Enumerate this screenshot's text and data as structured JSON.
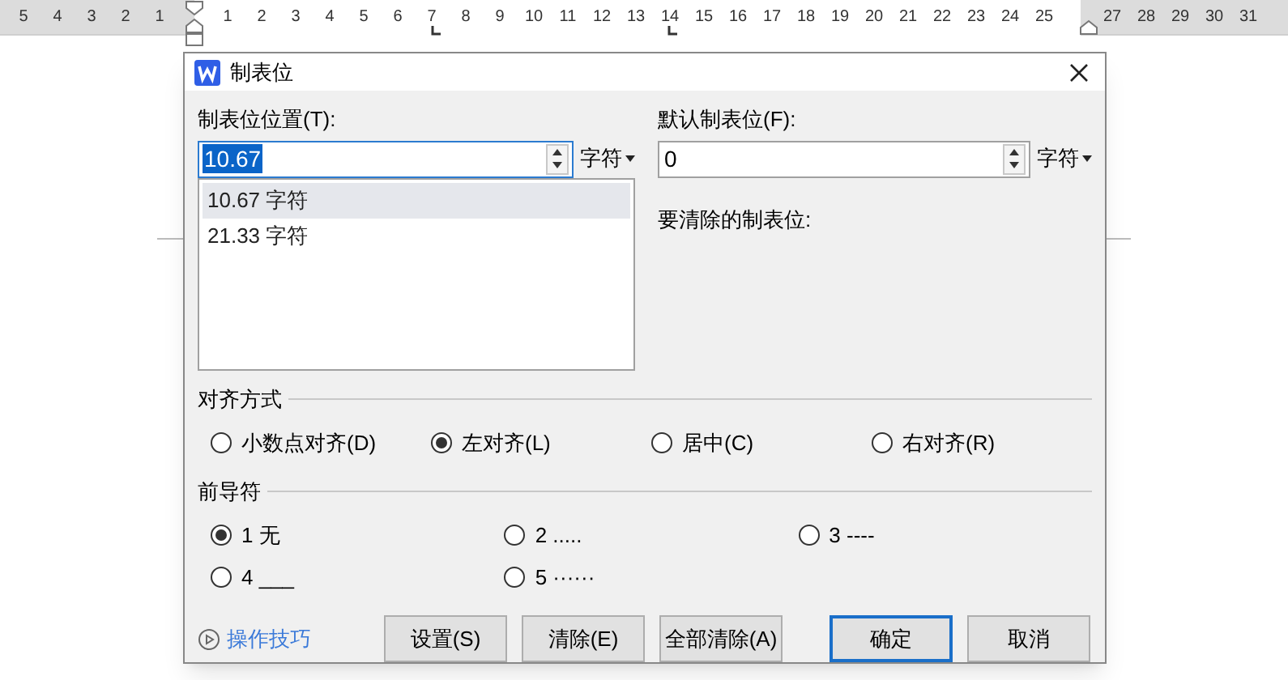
{
  "ruler": {
    "left_numbers": [
      "5",
      "4",
      "3",
      "2",
      "1"
    ],
    "numbers": [
      "1",
      "2",
      "3",
      "4",
      "5",
      "6",
      "7",
      "8",
      "9",
      "10",
      "11",
      "12",
      "13",
      "14",
      "15",
      "16",
      "17",
      "18",
      "19",
      "20",
      "21",
      "22",
      "23",
      "24",
      "25"
    ],
    "right_numbers": [
      "27",
      "28",
      "29",
      "30",
      "31"
    ]
  },
  "dialog": {
    "title": "制表位",
    "tab_position": {
      "label": "制表位位置(T):",
      "value": "10.67",
      "unit": "字符"
    },
    "tab_list": [
      {
        "text": "10.67 字符",
        "selected": true
      },
      {
        "text": "21.33 字符",
        "selected": false
      }
    ],
    "default_tab": {
      "label": "默认制表位(F):",
      "value": "0",
      "unit": "字符"
    },
    "clear_label": "要清除的制表位:",
    "alignment": {
      "title": "对齐方式",
      "options": [
        {
          "label": "小数点对齐(D)",
          "selected": false
        },
        {
          "label": "左对齐(L)",
          "selected": true
        },
        {
          "label": "居中(C)",
          "selected": false
        },
        {
          "label": "右对齐(R)",
          "selected": false
        }
      ]
    },
    "leader": {
      "title": "前导符",
      "options": [
        {
          "label": "1 无",
          "selected": true
        },
        {
          "label": "2 .....",
          "selected": false
        },
        {
          "label": "3 ----",
          "selected": false
        },
        {
          "label": "4 ___",
          "selected": false
        },
        {
          "label": "5 ······",
          "selected": false
        }
      ]
    },
    "tips": "操作技巧",
    "buttons": [
      {
        "label": "设置(S)",
        "default": false
      },
      {
        "label": "清除(E)",
        "default": false
      },
      {
        "label": "全部清除(A)",
        "default": false
      }
    ],
    "confirm_buttons": [
      {
        "label": "确定",
        "default": true
      },
      {
        "label": "取消",
        "default": false
      }
    ]
  }
}
